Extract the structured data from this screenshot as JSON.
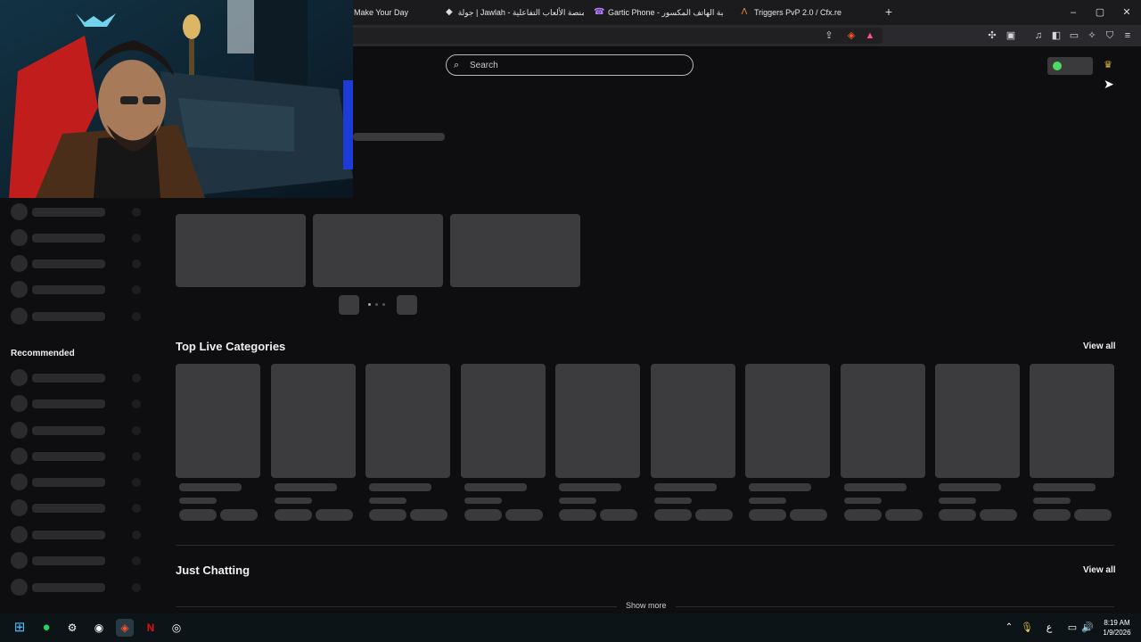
{
  "tabs": [
    {
      "title": "Make Your Day",
      "icon": "generic-tab-icon"
    },
    {
      "title": "جولة | Jawlah - منصة الألعاب التفاعلية",
      "icon": "jawlah-icon"
    },
    {
      "title": "Gartic Phone - لعبة الهاتف المكسور",
      "icon": "gartic-phone-icon"
    },
    {
      "title": "Triggers PvP 2.0 / Cfx.re",
      "icon": "cfx-icon"
    }
  ],
  "new_tab_label": "+",
  "window_controls": {
    "minimize": "–",
    "maximize": "▢",
    "close": "✕"
  },
  "search": {
    "placeholder": "Search"
  },
  "sidebar": {
    "recommended_label": "Recommended"
  },
  "sections": {
    "top_live_categories": {
      "title": "Top Live Categories",
      "view_all": "View all"
    },
    "just_chatting": {
      "title": "Just Chatting",
      "view_all": "View all"
    },
    "show_more": "Show more"
  },
  "taskbar": {
    "time": "8:19 AM",
    "date": "1/9/2026",
    "ime": "ع",
    "apps": [
      "windows-start-icon",
      "spotify-icon",
      "steam-icon",
      "obs-icon",
      "brave-icon",
      "netflix-icon",
      "app-icon"
    ]
  },
  "colors": {
    "page_bg": "#0e0e10",
    "skeleton": "#3c3c3f",
    "online_dot": "#4cd964"
  }
}
